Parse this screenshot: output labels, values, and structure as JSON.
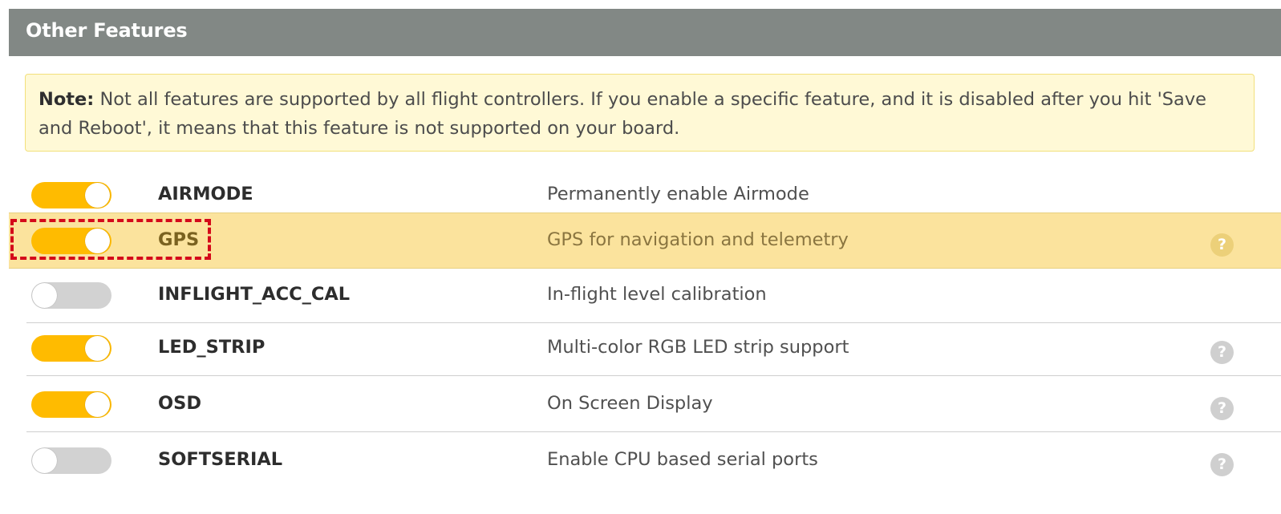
{
  "panel": {
    "title": "Other Features"
  },
  "note": {
    "label": "Note:",
    "text": " Not all features are supported by all flight controllers. If you enable a specific feature, and it is disabled after you hit 'Save and Reboot', it means that this feature is not supported on your board."
  },
  "features": [
    {
      "name": "AIRMODE",
      "description": "Permanently enable Airmode",
      "enabled": true,
      "help": false
    },
    {
      "name": "GPS",
      "description": "GPS for navigation and telemetry",
      "enabled": true,
      "help": true,
      "highlighted": true
    },
    {
      "name": "INFLIGHT_ACC_CAL",
      "description": "In-flight level calibration",
      "enabled": false,
      "help": false
    },
    {
      "name": "LED_STRIP",
      "description": "Multi-color RGB LED strip support",
      "enabled": true,
      "help": true
    },
    {
      "name": "OSD",
      "description": "On Screen Display",
      "enabled": true,
      "help": true
    },
    {
      "name": "SOFTSERIAL",
      "description": "Enable CPU based serial ports",
      "enabled": false,
      "help": true
    }
  ],
  "help_glyph": "?",
  "colors": {
    "header_bg": "#828885",
    "toggle_on": "#ffbb00",
    "toggle_off": "#d2d2d2",
    "highlight_row": "#fbe39d",
    "note_bg": "#fff9d6",
    "annotation": "#d4091a"
  }
}
